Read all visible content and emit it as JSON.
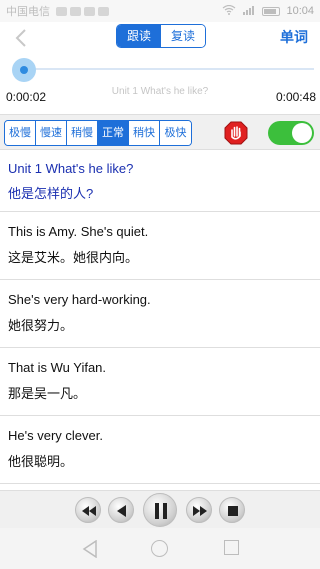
{
  "status_bar": {
    "carrier": "中国电信",
    "time": "10:04"
  },
  "header": {
    "back_icon": "chevron-left-icon",
    "tabs": [
      {
        "label": "跟读",
        "selected": true
      },
      {
        "label": "复读",
        "selected": false
      }
    ],
    "words_label": "单词"
  },
  "player": {
    "current_time": "0:00:02",
    "total_time": "0:00:48",
    "title": "Unit 1 What's he like?",
    "progress": 0.04
  },
  "speed": {
    "options": [
      "极慢",
      "慢速",
      "稍慢",
      "正常",
      "稍快",
      "极快"
    ],
    "selected": "正常"
  },
  "toggle_on": true,
  "unit": {
    "title_en": "Unit 1 What's he like?",
    "title_cn": "他是怎样的人?"
  },
  "sentences": [
    {
      "en": "This is Amy. She's quiet.",
      "cn": "这是艾米。她很内向。"
    },
    {
      "en": "She's very hard-working.",
      "cn": "她很努力。"
    },
    {
      "en": "That is Wu Yifan.",
      "cn": "那是吴一凡。"
    },
    {
      "en": "He's very clever.",
      "cn": "他很聪明。"
    }
  ],
  "controls": [
    "rewind-icon",
    "previous-icon",
    "pause-icon",
    "next-icon",
    "stop-icon"
  ],
  "colors": {
    "accent": "#1e6fd9",
    "toggle": "#3cbf3c",
    "stop_red": "#e02020",
    "unit_text": "#1a2fb0"
  }
}
